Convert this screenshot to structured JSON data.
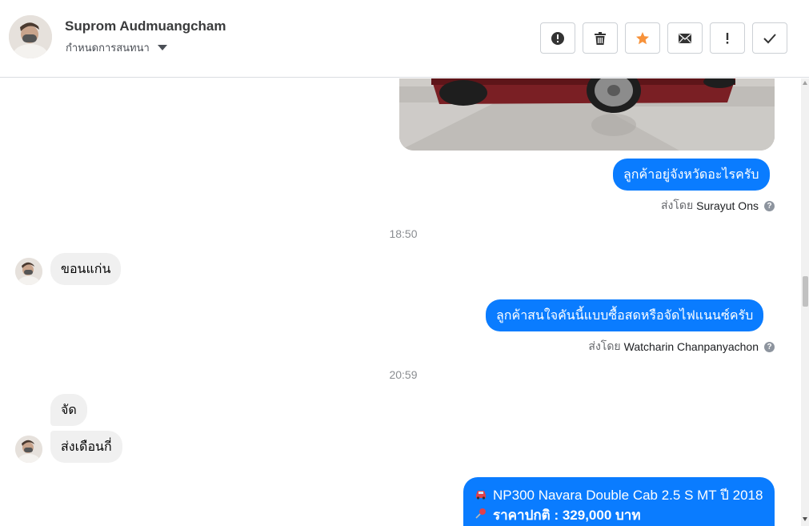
{
  "header": {
    "contact_name": "Suprom Audmuangcham",
    "conversation_settings": "กำหนดการสนทนา",
    "actions": [
      {
        "name": "report-spam",
        "icon": "alert-circle-icon"
      },
      {
        "name": "delete",
        "icon": "trash-icon"
      },
      {
        "name": "star",
        "icon": "star-icon",
        "color": "#f7923a"
      },
      {
        "name": "mark-unread",
        "icon": "envelope-icon"
      },
      {
        "name": "follow-up",
        "icon": "exclamation-icon"
      },
      {
        "name": "mark-done",
        "icon": "check-icon"
      }
    ]
  },
  "messages": {
    "out_1": "ลูกค้าอยู่จังหวัดอะไรครับ",
    "sent_by_label_1": "ส่งโดย",
    "sent_by_name_1": "Surayut Ons",
    "time_1": "18:50",
    "in_1": "ขอนแก่น",
    "out_2": "ลูกค้าสนใจคันนี้แบบซื้อสดหรือจัดไฟแนนซ์ครับ",
    "sent_by_label_2": "ส่งโดย",
    "sent_by_name_2": "Watcharin Chanpanyachon",
    "time_2": "20:59",
    "in_2": "จัด",
    "in_3": "ส่งเดือนกี่",
    "listing_line_1": "NP300 Navara Double Cab 2.5 S MT ปี 2018",
    "listing_line_2": "ราคาปกติ : 329,000 บาท"
  },
  "colors": {
    "outgoing_bubble": "#0a7cff",
    "incoming_bubble": "#f0f0f0",
    "star": "#f7923a"
  }
}
